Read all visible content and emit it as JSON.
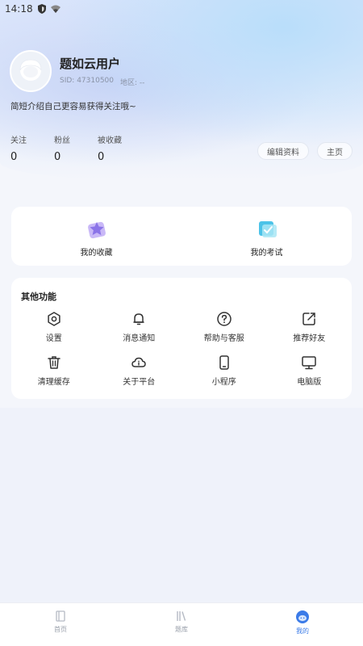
{
  "status_bar": {
    "time": "14:18"
  },
  "profile": {
    "username": "题如云用户",
    "sid": "SID: 47310500",
    "region": "地区: --",
    "bio": "简短介绍自己更容易获得关注哦~"
  },
  "stats": [
    {
      "label": "关注",
      "value": "0"
    },
    {
      "label": "粉丝",
      "value": "0"
    },
    {
      "label": "被收藏",
      "value": "0"
    }
  ],
  "buttons": {
    "edit_profile": "编辑资料",
    "homepage": "主页"
  },
  "quick": [
    {
      "label": "我的收藏",
      "icon": "star-favorites-icon"
    },
    {
      "label": "我的考试",
      "icon": "exam-icon"
    }
  ],
  "functions": {
    "title": "其他功能",
    "items": [
      {
        "label": "设置",
        "icon": "settings-icon"
      },
      {
        "label": "消息通知",
        "icon": "bell-icon"
      },
      {
        "label": "帮助与客服",
        "icon": "help-icon"
      },
      {
        "label": "推荐好友",
        "icon": "share-edit-icon"
      },
      {
        "label": "清理缓存",
        "icon": "trash-icon"
      },
      {
        "label": "关于平台",
        "icon": "cloud-info-icon"
      },
      {
        "label": "小程序",
        "icon": "phone-icon"
      },
      {
        "label": "电脑版",
        "icon": "monitor-icon"
      }
    ]
  },
  "tabs": [
    {
      "label": "首页",
      "icon": "book-icon",
      "active": false
    },
    {
      "label": "题库",
      "icon": "library-icon",
      "active": false
    },
    {
      "label": "我的",
      "icon": "profile-face-icon",
      "active": true
    }
  ],
  "colors": {
    "accent": "#3b7be8",
    "header_blue": "#b9defa",
    "favorites_purple": "#8b74e8",
    "exam_cyan": "#4cc3e8"
  }
}
